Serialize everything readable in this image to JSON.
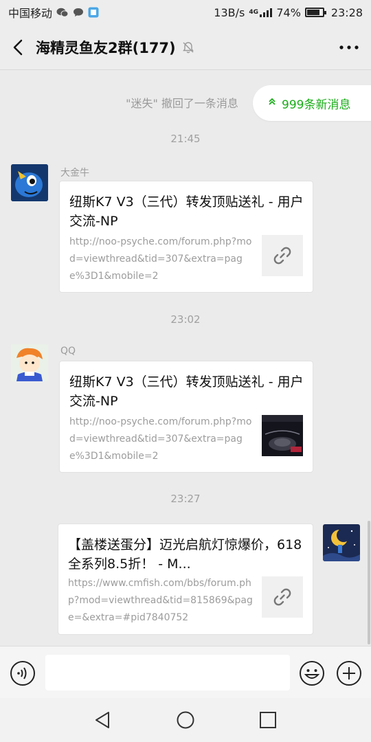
{
  "status_bar": {
    "carrier": "中国移动",
    "speed": "13B/s",
    "network": "4G",
    "battery": "74%",
    "time": "23:28"
  },
  "header": {
    "title": "海精灵鱼友2群(177)",
    "back_icon": "chevron-left-icon",
    "more_icon": "more-dots-icon"
  },
  "new_messages_pill": "999条新消息",
  "recall_notice": "\"迷失\" 撤回了一条消息",
  "messages": [
    {
      "time": "21:45",
      "sender": "大金牛",
      "title": "纽斯K7 V3（三代）转发顶贴送礼 - 用户交流-NP",
      "url": "http://noo-psyche.com/forum.php?mod=viewthread&tid=307&extra=page%3D1&mobile=2",
      "thumb": "link-icon"
    },
    {
      "time": "23:02",
      "sender": "QQ",
      "title": "纽斯K7 V3（三代）转发顶贴送礼 - 用户交流-NP",
      "url": "http://noo-psyche.com/forum.php?mod=viewthread&tid=307&extra=page%3D1&mobile=2",
      "thumb": "image"
    },
    {
      "time": "23:27",
      "sender": "",
      "title": "【盖楼送蛋分】迈光启航灯惊爆价，618全系列8.5折！ - M...",
      "url": "https://www.cmfish.com/bbs/forum.php?mod=viewthread&tid=815869&page=&extra=#pid7840752",
      "thumb": "link-icon"
    }
  ],
  "input_placeholder": ""
}
